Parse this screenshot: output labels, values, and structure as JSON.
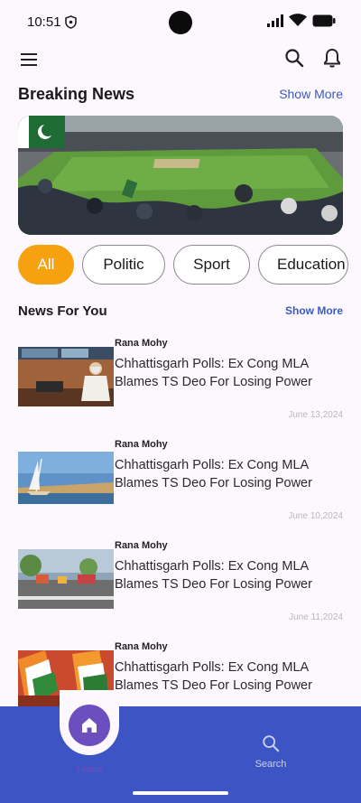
{
  "status_bar": {
    "time": "10:51",
    "icons": [
      "shield-icon",
      "signal-icon",
      "wifi-icon",
      "battery-icon"
    ]
  },
  "app_bar": {
    "icons": [
      "menu-icon",
      "search-icon",
      "bell-icon"
    ]
  },
  "breaking": {
    "title": "Breaking News",
    "show_more": "Show More"
  },
  "categories": [
    "All",
    "Politic",
    "Sport",
    "Education"
  ],
  "selected_category": "All",
  "for_you": {
    "title": "News For You",
    "show_more": "Show More"
  },
  "articles": [
    {
      "author": "Rana Mohy",
      "title": "Chhattisgarh Polls: Ex Cong MLA Blames TS Deo For Losing Power",
      "date": "June 13,2024"
    },
    {
      "author": "Rana Mohy",
      "title": "Chhattisgarh Polls: Ex Cong MLA Blames TS Deo For Losing Power",
      "date": "June 10,2024"
    },
    {
      "author": "Rana Mohy",
      "title": "Chhattisgarh Polls: Ex Cong MLA Blames TS Deo For Losing Power",
      "date": "June 11,2024"
    },
    {
      "author": "Rana Mohy",
      "title": "Chhattisgarh Polls: Ex Cong MLA Blames TS Deo For Losing Power",
      "date": ""
    }
  ],
  "bottom_nav": {
    "home_label": "Home",
    "search_label": "Search"
  },
  "colors": {
    "accent": "#3d55c4",
    "chip_active": "#f6a10f",
    "home_button": "#6b4fbf"
  }
}
